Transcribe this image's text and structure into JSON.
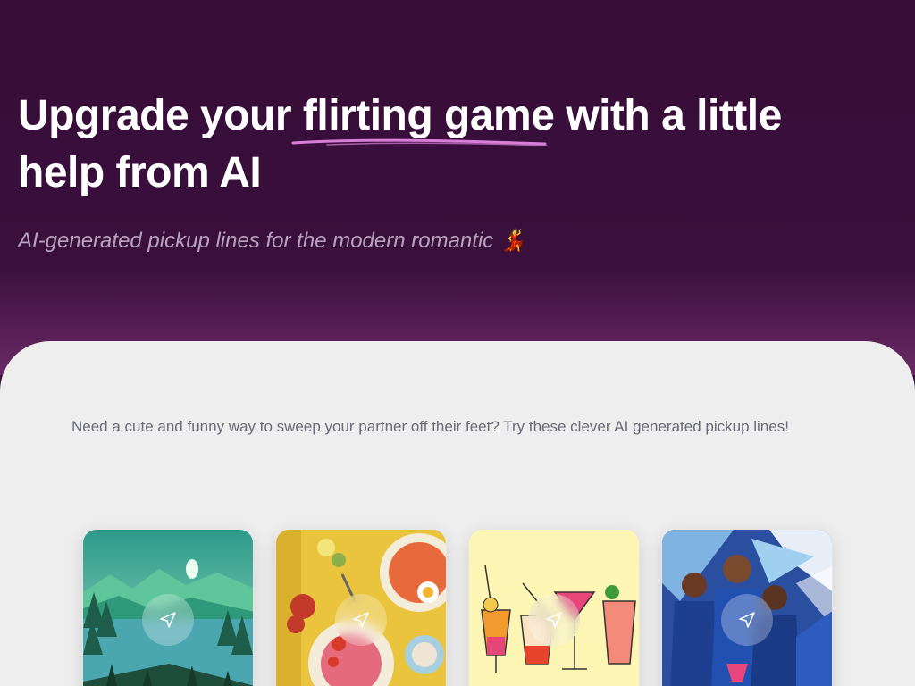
{
  "hero": {
    "title_before": "Upgrade your ",
    "title_highlight": "flirting game",
    "title_after": " with a little help from AI",
    "subtitle": "AI-generated pickup lines for the modern romantic 💃"
  },
  "intro": {
    "text": "Need a cute and funny way to sweep your partner off their feet? Try these clever AI generated pickup lines!"
  },
  "cards": [
    {
      "theme": "nature-lake"
    },
    {
      "theme": "food"
    },
    {
      "theme": "cocktails"
    },
    {
      "theme": "cricket"
    }
  ],
  "colors": {
    "hero_bg": "#38103a",
    "panel_bg": "#eeeeee",
    "underline": "#d77fd6"
  }
}
